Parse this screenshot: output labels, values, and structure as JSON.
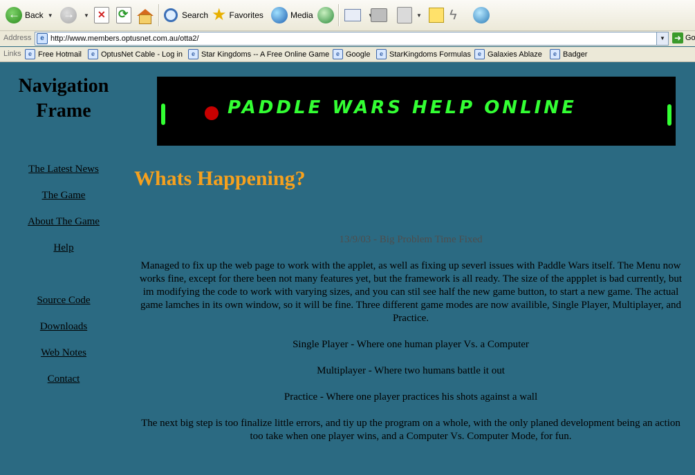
{
  "toolbar": {
    "back_label": "Back",
    "search_label": "Search",
    "favorites_label": "Favorites",
    "media_label": "Media"
  },
  "address_bar": {
    "label": "Address",
    "url": "http://www.members.optusnet.com.au/otta2/",
    "go_label": "Go"
  },
  "links_bar": {
    "label": "Links",
    "items": [
      "Free Hotmail",
      "OptusNet Cable - Log in",
      "Star Kingdoms -- A Free Online Game",
      "Google",
      "StarKingdoms Formulas",
      "Galaxies Ablaze",
      "Badger"
    ]
  },
  "nav": {
    "title_line1": "Navigation",
    "title_line2": "Frame",
    "links": [
      "The Latest News",
      "The Game",
      "About The Game",
      "Help",
      "Source Code",
      "Downloads",
      "Web Notes",
      "Contact"
    ]
  },
  "banner": {
    "text": "PADDLE WARS HELP ONLINE",
    "text_color": "#33ff33",
    "ball_color": "#c80000"
  },
  "main": {
    "heading": "Whats Happening?",
    "news_date_title": "13/9/03 - Big Problem Time Fixed",
    "paragraphs": [
      "Managed to fix up the web page to work with the applet, as well as fixing up severl issues with Paddle Wars itself. The Menu now works fine, except for there been not many features yet, but the framework is all ready. The size of the appplet is bad currently, but im modifying the code to work with varying sizes, and you can stil see half the new game button, to start a new game. The actual game lamches in its own window, so it will be fine. Three different game modes are now availible, Single Player, Multiplayer, and Practice.",
      "Single Player - Where one human player Vs. a Computer",
      "Multiplayer - Where two humans battle it out",
      "Practice - Where one player practices his shots against a wall",
      "The next big step is too finalize little errors, and tiy up the program on a whole, with the only planed development being an action too take when one player wins, and a Computer Vs. Computer Mode, for fun."
    ]
  },
  "colors": {
    "page_background": "#2b6a82",
    "heading": "#f7a11d"
  }
}
